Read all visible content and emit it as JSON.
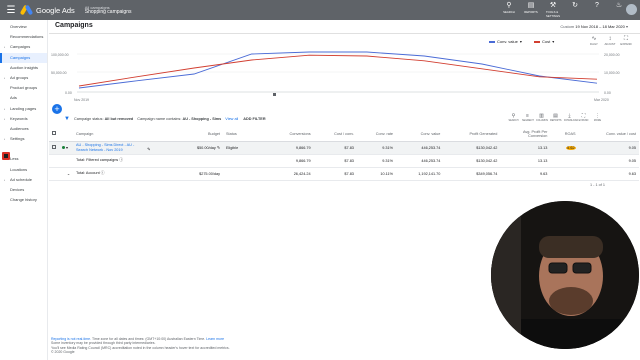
{
  "app": {
    "logo_text": "Google Ads",
    "breadcrumb_top": "All campaigns",
    "breadcrumb_main": "Shopping campaigns"
  },
  "toolbar": {
    "search": "SEARCH",
    "reports": "REPORTS",
    "tools": "TOOLS & SETTINGS"
  },
  "sidebar": {
    "items": [
      {
        "label": "Overview",
        "active": false,
        "bullet": false
      },
      {
        "label": "Recommendations",
        "active": false,
        "bullet": false
      },
      {
        "label": "Campaigns",
        "active": false,
        "bullet": true
      },
      {
        "label": "Campaigns",
        "active": true,
        "bullet": false
      },
      {
        "label": "Auction insights",
        "active": false,
        "bullet": false
      },
      {
        "label": "Ad groups",
        "active": false,
        "bullet": true
      },
      {
        "label": "Product groups",
        "active": false,
        "bullet": false
      },
      {
        "label": "Ads",
        "active": false,
        "bullet": false
      },
      {
        "label": "Landing pages",
        "active": false,
        "bullet": true
      },
      {
        "label": "Keywords",
        "active": false,
        "bullet": true
      },
      {
        "label": "Audiences",
        "active": false,
        "bullet": false
      },
      {
        "label": "Settings",
        "active": false,
        "bullet": true
      },
      {
        "label": "",
        "active": false,
        "bullet": false
      },
      {
        "label": "Less",
        "active": false,
        "bullet": true
      },
      {
        "label": "Locations",
        "active": false,
        "bullet": false
      },
      {
        "label": "Ad schedule",
        "active": false,
        "bullet": true
      },
      {
        "label": "Devices",
        "active": false,
        "bullet": false
      },
      {
        "label": "Change history",
        "active": false,
        "bullet": false
      }
    ]
  },
  "page": {
    "title": "Campaigns",
    "range_label": "Custom",
    "range_value": "19 Nov 2018 – 18 Mar 2020"
  },
  "chart_controls": {
    "metric1": "Conv. value",
    "metric1_color": "#4a6bd6",
    "metric2": "Cost",
    "metric2_color": "#d23f31",
    "tools": [
      "DAILY",
      "ADJUST",
      "EXPAND"
    ]
  },
  "chart_data": {
    "type": "line",
    "y_ticks_left": [
      "100,000.00",
      "50,000.00",
      "0.00"
    ],
    "y_ticks_right": [
      "20,000.00",
      "10,000.00",
      "0.00"
    ],
    "x_labels": [
      "Nov 2019",
      "Mar 2020"
    ],
    "series": [
      {
        "name": "Conv. value",
        "color": "#4a6bd6",
        "values": [
          10,
          28,
          45,
          95,
          100,
          100,
          90,
          70,
          40,
          22
        ]
      },
      {
        "name": "Cost",
        "color": "#d23f31",
        "values": [
          15,
          38,
          60,
          80,
          92,
          90,
          78,
          58,
          38,
          32
        ]
      }
    ]
  },
  "filter": {
    "status_label": "Campaign status:",
    "status_value": "All but removed",
    "name_label": "Campaign name contains:",
    "name_value": "AU - Shopping - Sims",
    "view_all": "View all",
    "add_filter": "ADD FILTER"
  },
  "table_tools": [
    "SEARCH",
    "SEGMENT",
    "COLUMNS",
    "REPORTS",
    "DOWNLOAD",
    "EXPAND",
    "MORE"
  ],
  "table": {
    "headers": [
      "Campaign",
      "Budget",
      "Status",
      "Conversions",
      "Cost / conv.",
      "Conv. rate",
      "Conv. value",
      "Profit Generated",
      "Avg. Profit Per Conversion",
      "ROAS",
      "Conv. value / cost"
    ],
    "rows": [
      {
        "campaign": "AU - Shopping - Sims Direct - AU - Search Network - Nov 2019",
        "budget": "$50.00/day",
        "status": "Eligible",
        "conversions": "9,866.79",
        "cost_conv": "$7.83",
        "conv_rate": "9.31%",
        "conv_value": "446,253.74",
        "profit": "$130,042.42",
        "avg_profit": "13.13",
        "roas": "5.62",
        "cvc": "9.05"
      },
      {
        "campaign": "Total: Filtered campaigns",
        "budget": "",
        "status": "",
        "conversions": "9,866.79",
        "cost_conv": "$7.83",
        "conv_rate": "9.31%",
        "conv_value": "446,253.74",
        "profit": "$130,042.42",
        "avg_profit": "13.13",
        "roas": "",
        "cvc": "9.05"
      },
      {
        "campaign": "Total: Account",
        "budget": "$275.00/day",
        "status": "",
        "conversions": "26,424.24",
        "cost_conv": "$7.83",
        "conv_rate": "10.11%",
        "conv_value": "1,192,141.70",
        "profit": "$349,056.74",
        "avg_profit": "9.63",
        "roas": "",
        "cvc": "9.63"
      }
    ],
    "pager": "1 - 1 of 1"
  },
  "footer": {
    "line1_link": "Reporting is not real-time.",
    "line1": "Time zone for all dates and times: (GMT+10:00) Australian Eastern Time.",
    "line1_link2": "Learn more",
    "line2": "Some inventory may be provided through third party intermediaries.",
    "line3": "You'll see Media Rating Council (MRC) accreditation noted in the column header's hover text for accredited metrics.",
    "line4": "© 2020 Google"
  }
}
